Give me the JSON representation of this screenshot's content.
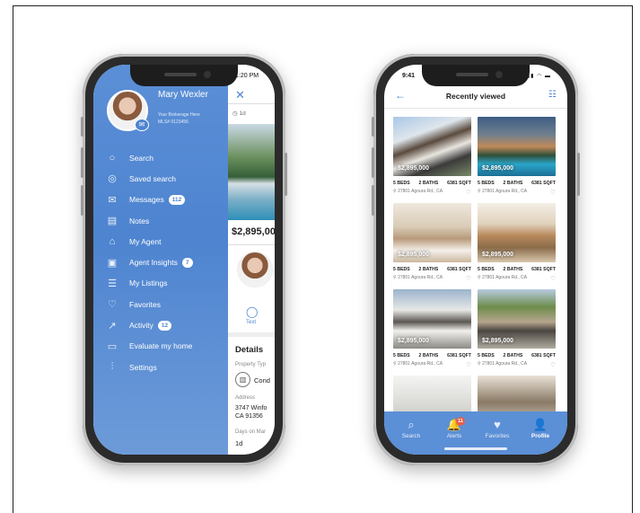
{
  "left_phone": {
    "status_time": "1:20 PM",
    "agent": {
      "name": "Mary Wexler",
      "brokerage": "Your Brokerage Here",
      "mls": "MLS# 0123456"
    },
    "menu": [
      {
        "label": "Search",
        "icon": "search-icon",
        "glyph": "○",
        "count": ""
      },
      {
        "label": "Saved search",
        "icon": "saved-search-icon",
        "glyph": "◎",
        "count": ""
      },
      {
        "label": "Messages",
        "icon": "envelope-icon",
        "glyph": "✉",
        "count": "112"
      },
      {
        "label": "Notes",
        "icon": "notes-icon",
        "glyph": "▤",
        "count": ""
      },
      {
        "label": "My Agent",
        "icon": "house-icon",
        "glyph": "⌂",
        "count": ""
      },
      {
        "label": "Agent Insights",
        "icon": "insights-icon",
        "glyph": "▣",
        "count": "7"
      },
      {
        "label": "My Listings",
        "icon": "listings-icon",
        "glyph": "☰",
        "count": ""
      },
      {
        "label": "Favorites",
        "icon": "heart-icon",
        "glyph": "♡",
        "count": ""
      },
      {
        "label": "Activity",
        "icon": "activity-icon",
        "glyph": "↗",
        "count": "12"
      },
      {
        "label": "Evaluate my home",
        "icon": "evaluate-icon",
        "glyph": "▭",
        "count": ""
      },
      {
        "label": "Settings",
        "icon": "sliders-icon",
        "glyph": "⫶",
        "count": ""
      }
    ],
    "detail": {
      "age": "1d",
      "price": "$2,895,00",
      "text_label": "Text",
      "section_title": "Details",
      "property_type_label": "Property Typ",
      "property_type": "Cond",
      "address_label": "Address",
      "address_line1": "3747 Winfo",
      "address_line2": "CA 91356",
      "days_label": "Days on Mar",
      "days_value": "1d"
    }
  },
  "right_phone": {
    "status_time": "9:41",
    "title": "Recently viewed",
    "listings": [
      {
        "price": "$2,895,000",
        "beds": "5 BEDS",
        "baths": "2 BATHS",
        "sqft": "6381 SQFT",
        "address": "27801 Agoura Rd., CA",
        "photo": "modern-exterior"
      },
      {
        "price": "$2,895,000",
        "beds": "5 BEDS",
        "baths": "2 BATHS",
        "sqft": "6381 SQFT",
        "address": "27801 Agoura Rd., CA",
        "photo": "pool-dusk"
      },
      {
        "price": "$2,895,000",
        "beds": "5 BEDS",
        "baths": "2 BATHS",
        "sqft": "6381 SQFT",
        "address": "27801 Agoura Rd., CA",
        "photo": "bedroom"
      },
      {
        "price": "$2,895,000",
        "beds": "5 BEDS",
        "baths": "2 BATHS",
        "sqft": "6381 SQFT",
        "address": "27801 Agoura Rd., CA",
        "photo": "living-room"
      },
      {
        "price": "$2,895,000",
        "beds": "5 BEDS",
        "baths": "2 BATHS",
        "sqft": "6381 SQFT",
        "address": "27801 Agoura Rd., CA",
        "photo": "white-modern"
      },
      {
        "price": "$2,895,000",
        "beds": "5 BEDS",
        "baths": "2 BATHS",
        "sqft": "6381 SQFT",
        "address": "27801 Agoura Rd., CA",
        "photo": "garage-house"
      }
    ],
    "tabs": [
      {
        "label": "Search",
        "icon": "search-icon",
        "glyph": "⌕",
        "active": false
      },
      {
        "label": "Alerts",
        "icon": "bell-icon",
        "glyph": "🔔",
        "active": false,
        "badge": "11"
      },
      {
        "label": "Favorites",
        "icon": "heart-icon",
        "glyph": "♥",
        "active": false
      },
      {
        "label": "Profile",
        "icon": "person-icon",
        "glyph": "👤",
        "active": true
      }
    ]
  },
  "colors": {
    "accent": "#4e84d0",
    "drawer": "#5b8fd6",
    "badge_red": "#e85d4a"
  }
}
